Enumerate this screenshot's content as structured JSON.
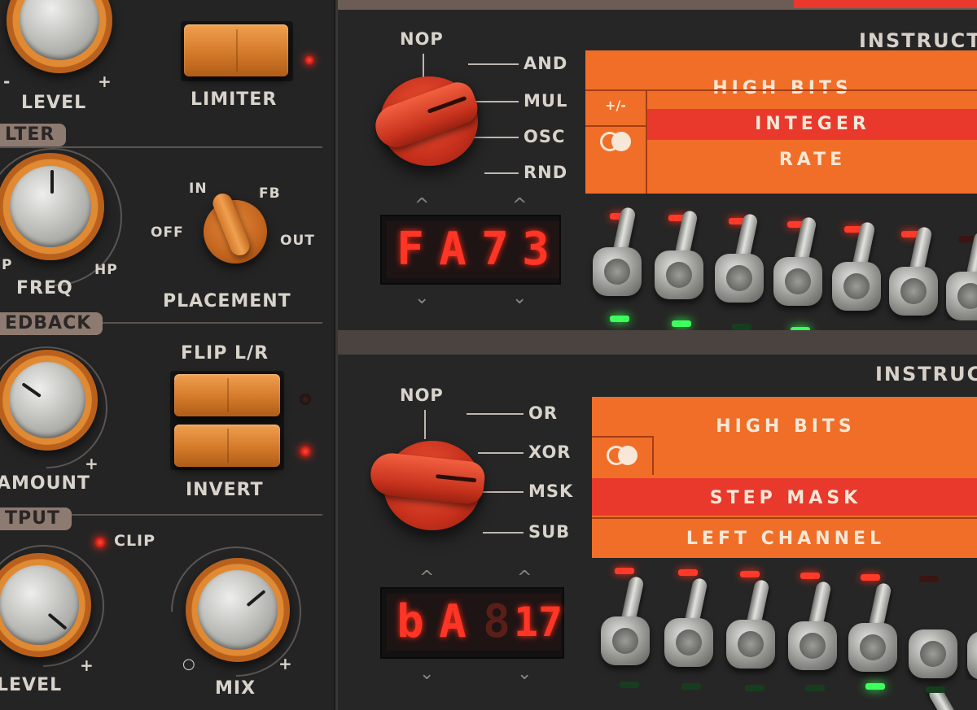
{
  "left": {
    "level_label": "LEVEL",
    "level_plus": "+",
    "level_minus": "-",
    "limiter_label": "LIMITER",
    "filter_section": "LTER",
    "freq_label": "FREQ",
    "freq_lp": "P",
    "freq_hp": "HP",
    "placement": {
      "label": "PLACEMENT",
      "positions": [
        "OFF",
        "IN",
        "FB",
        "OUT"
      ]
    },
    "feedback_section": "EDBACK",
    "amount_label": "AMOUNT",
    "amount_plus": "+",
    "flip_label": "FLIP L/R",
    "invert_label": "INVERT",
    "output_section": "TPUT",
    "clip_label": "CLIP",
    "out_level_label": "LEVEL",
    "out_level_plus": "+",
    "mix_label": "MIX",
    "mix_min": "○",
    "mix_plus": "+"
  },
  "instr1": {
    "title": "INSTRUCT",
    "selector": [
      "NOP",
      "AND",
      "MUL",
      "OSC",
      "RND"
    ],
    "display_digits": [
      "F",
      "A",
      "7",
      "3"
    ],
    "panel": {
      "row1": "HIGH BITS",
      "sign": "+/-",
      "row2": "INTEGER",
      "row3": "RATE"
    }
  },
  "instr2": {
    "title": "INSTRUC",
    "selector": [
      "NOP",
      "OR",
      "XOR",
      "MSK",
      "SUB"
    ],
    "display_digits": [
      "b",
      "A",
      "8",
      "17"
    ],
    "panel": {
      "row1": "HIGH BITS",
      "row2": "STEP MASK",
      "row3": "LEFT CHANNEL"
    }
  },
  "colors": {
    "accent_orange": "#f06e27",
    "accent_red": "#e8392c",
    "led_red": "#ff3a28",
    "led_green": "#3dff5e"
  }
}
